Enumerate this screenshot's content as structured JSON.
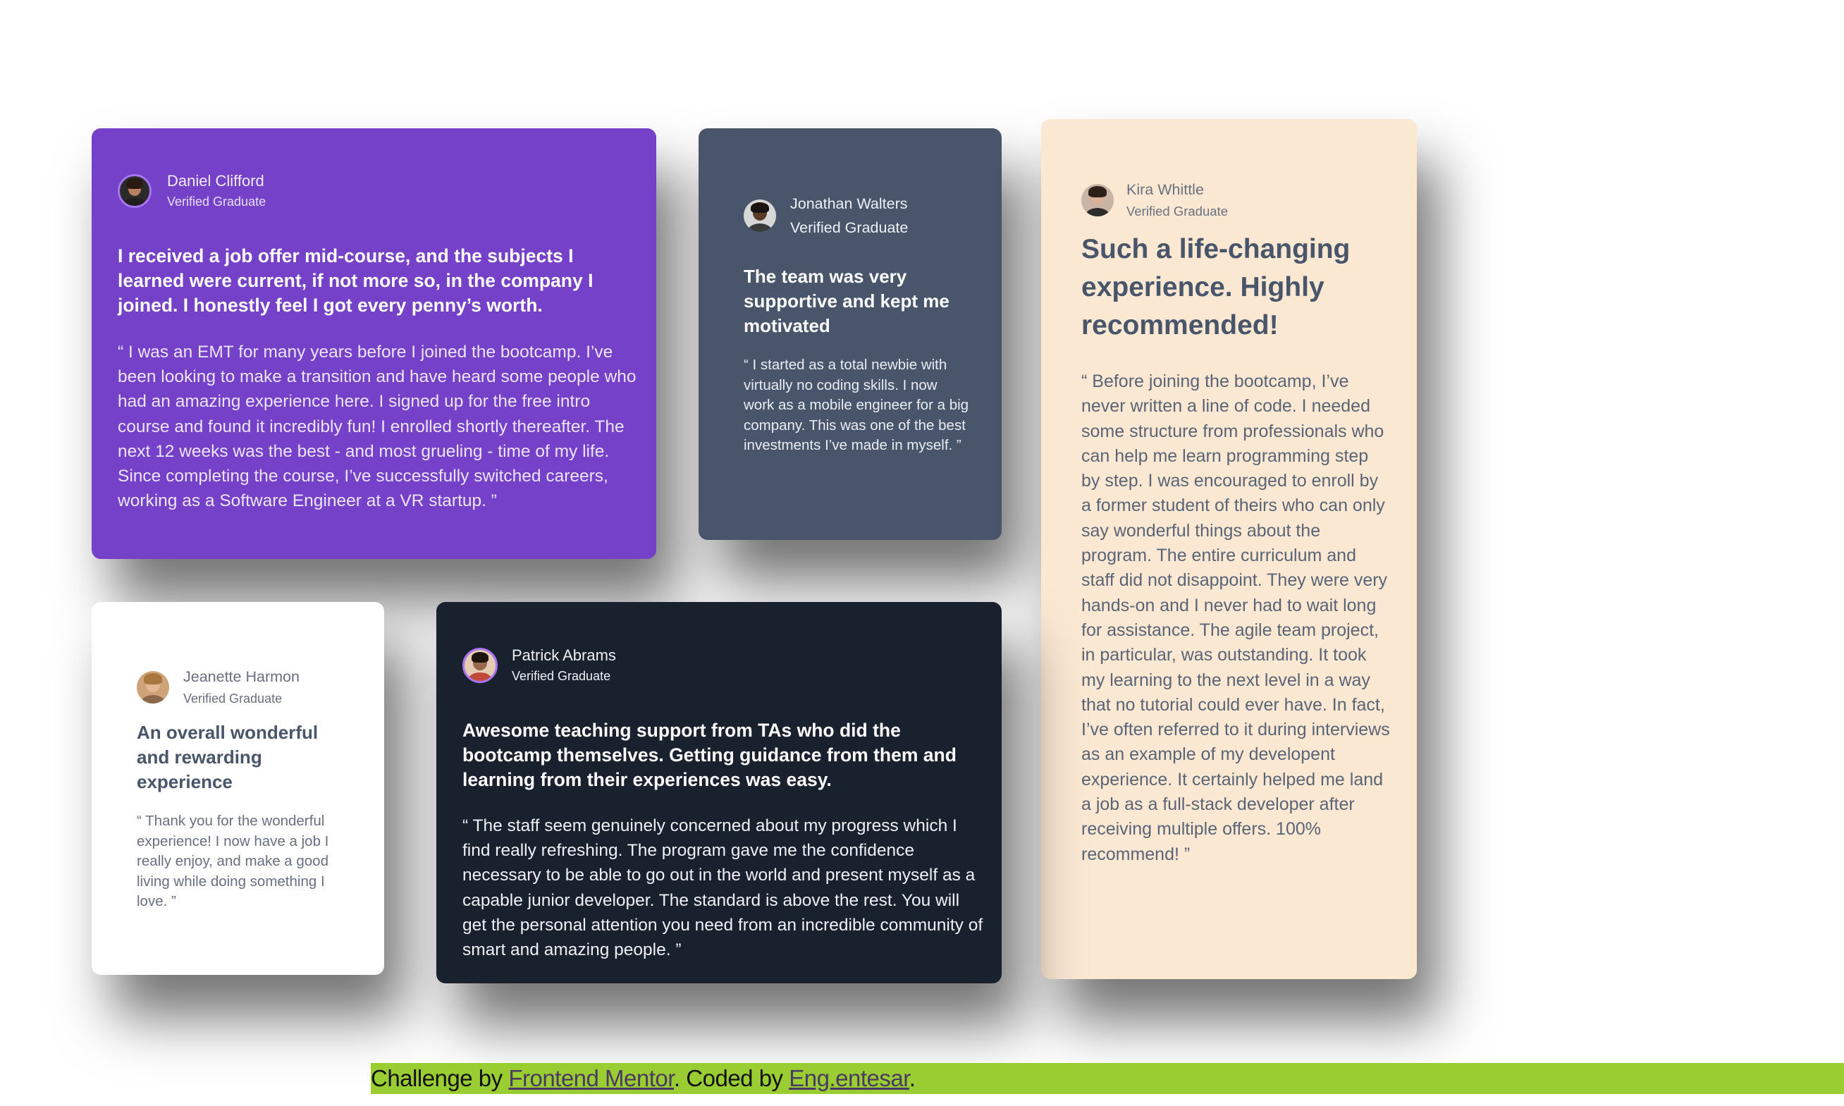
{
  "colors": {
    "purple": "#7541c8",
    "grey_blue": "#48556a",
    "dark": "#19212e",
    "beige": "#fae8d3",
    "white": "#ffffff",
    "attribution_bar": "#9acd32"
  },
  "testimonials": [
    {
      "name": "Daniel Clifford",
      "role": "Verified Graduate",
      "headline": "I received a job offer mid-course, and the subjects I learned were current, if not more so, in the company I joined. I honestly feel I got every penny’s worth.",
      "quote": "“ I was an EMT for many years before I joined the bootcamp. I’ve been looking to make a transition and have heard some people who had an amazing experience here. I signed up for the free intro course and found it incredibly fun! I enrolled shortly thereafter. The next 12 weeks was the best - and most grueling - time of my life. Since completing the course, I’ve successfully switched careers, working as a Software Engineer at a VR startup. ”"
    },
    {
      "name": "Jonathan Walters",
      "role": "Verified Graduate",
      "headline": "The team was very supportive and kept me motivated",
      "quote": "“ I started as a total newbie with virtually no coding skills. I now work as a mobile engineer for a big company. This was one of the best investments I’ve made in myself. ”"
    },
    {
      "name": "Kira Whittle",
      "role": "Verified Graduate",
      "headline": "Such a life-changing experience. Highly recommended!",
      "quote": "“ Before joining the bootcamp, I’ve never written a line of code. I needed some structure from professionals who can help me learn programming step by step. I was encouraged to enroll by a former student of theirs who can only say wonderful things about the program. The entire curriculum and staff did not disappoint. They were very hands-on and I never had to wait long for assistance. The agile team project, in particular, was outstanding. It took my learning to the next level in a way that no tutorial could ever have. In fact, I’ve often referred to it during interviews as an example of my developent experience. It certainly helped me land a job as a full-stack developer after receiving multiple offers. 100% recommend! ”"
    },
    {
      "name": "Jeanette Harmon",
      "role": "Verified Graduate",
      "headline": "An overall wonderful and rewarding experience",
      "quote": "“ Thank you for the wonderful experience! I now have a job I really enjoy, and make a good living while doing something I love. ”"
    },
    {
      "name": "Patrick Abrams",
      "role": "Verified Graduate",
      "headline": "Awesome teaching support from TAs who did the bootcamp themselves. Getting guidance from them and learning from their experiences was easy.",
      "quote": "“ The staff seem genuinely concerned about my progress which I find really refreshing. The program gave me the confidence necessary to be able to go out in the world and present myself as a capable junior developer. The standard is above the rest. You will get the personal attention you need from an incredible community of smart and amazing people. ”"
    }
  ],
  "attribution": {
    "prefix": "Challenge by ",
    "link1": "Frontend Mentor",
    "middle": ". Coded by ",
    "link2": "Eng.entesar",
    "suffix": "."
  }
}
